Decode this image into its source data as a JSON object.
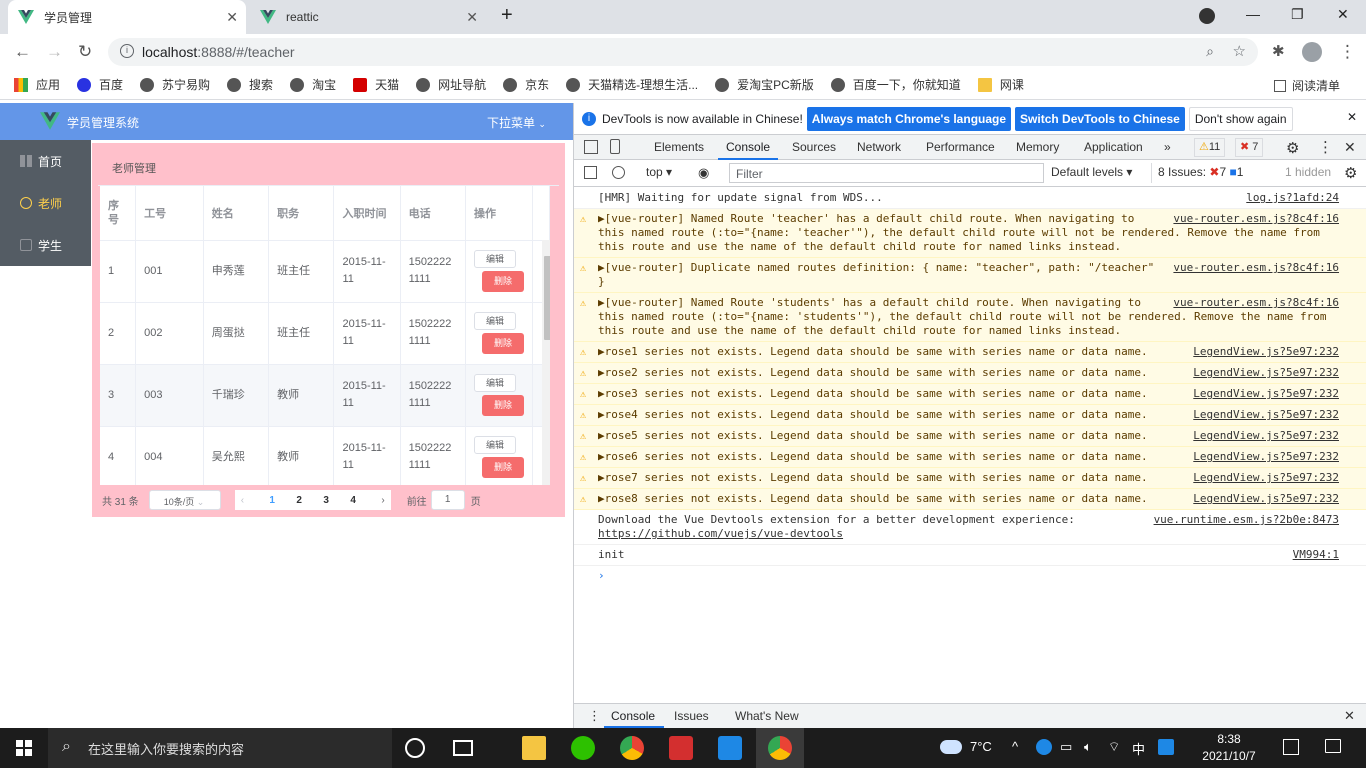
{
  "browser": {
    "tabs": [
      {
        "title": "学员管理",
        "active": true
      },
      {
        "title": "reattic",
        "active": false
      }
    ],
    "url_host": "localhost",
    "url_rest": ":8888/#/teacher",
    "bookmarks": [
      "应用",
      "百度",
      "苏宁易购",
      "搜索",
      "淘宝",
      "天猫",
      "网址导航",
      "京东",
      "天猫精选-理想生活...",
      "爱淘宝PC新版",
      "百度一下，你就知道",
      "网课"
    ],
    "reading_list": "阅读清单"
  },
  "app": {
    "title": "学员管理系统",
    "dropdown": "下拉菜单",
    "sidebar": [
      {
        "label": "首页",
        "active": false
      },
      {
        "label": "老师",
        "active": true
      },
      {
        "label": "学生",
        "active": false
      }
    ],
    "panel_title": "老师管理",
    "table": {
      "headers": [
        "序号",
        "工号",
        "姓名",
        "职务",
        "入职时间",
        "电话",
        "操作"
      ],
      "rows": [
        {
          "idx": "1",
          "id": "001",
          "name": "申秀莲",
          "role": "班主任",
          "date": "2015-11-11",
          "phone": "15022221111"
        },
        {
          "idx": "2",
          "id": "002",
          "name": "周蛋挞",
          "role": "班主任",
          "date": "2015-11-11",
          "phone": "15022221111"
        },
        {
          "idx": "3",
          "id": "003",
          "name": "千瑞珍",
          "role": "教师",
          "date": "2015-11-11",
          "phone": "15022221111"
        },
        {
          "idx": "4",
          "id": "004",
          "name": "吴允熙",
          "role": "教师",
          "date": "2015-11-11",
          "phone": "15022221111"
        }
      ],
      "edit_label": "编辑",
      "delete_label": "删除"
    },
    "pagination": {
      "total": "共 31 条",
      "page_size": "10条/页",
      "pages": [
        "1",
        "2",
        "3",
        "4"
      ],
      "current": "1",
      "goto_label": "前往",
      "goto_value": "1",
      "page_suffix": "页"
    }
  },
  "devtools": {
    "infobar": {
      "text": "DevTools is now available in Chinese!",
      "btn_match": "Always match Chrome's language",
      "btn_switch": "Switch DevTools to Chinese",
      "btn_dismiss": "Don't show again"
    },
    "tabs": [
      "Elements",
      "Console",
      "Sources",
      "Network",
      "Performance",
      "Memory",
      "Application"
    ],
    "warn_count": "11",
    "error_count": "7",
    "context": "top",
    "filter_placeholder": "Filter",
    "levels": "Default levels",
    "issues_label": "8 Issues:",
    "issues_errors": "7",
    "issues_info": "1",
    "hidden": "1 hidden",
    "messages": [
      {
        "type": "log",
        "text": "[HMR] Waiting for update signal from WDS...",
        "source": "log.js?1afd:24"
      },
      {
        "type": "warn",
        "text": "▶[vue-router] Named Route 'teacher' has a default child route. When navigating to\nthis named route (:to=\"{name: 'teacher'\"), the default child route will not be rendered. Remove the name from\nthis route and use the name of the default child route for named links instead.",
        "source": "vue-router.esm.js?8c4f:16"
      },
      {
        "type": "warn",
        "text": "▶[vue-router] Duplicate named routes definition: { name: \"teacher\", path: \"/teacher\"\n}",
        "source": "vue-router.esm.js?8c4f:16"
      },
      {
        "type": "warn",
        "text": "▶[vue-router] Named Route 'students' has a default child route. When navigating to\nthis named route (:to=\"{name: 'students'\"), the default child route will not be rendered. Remove the name from\nthis route and use the name of the default child route for named links instead.",
        "source": "vue-router.esm.js?8c4f:16"
      },
      {
        "type": "warn",
        "text": "▶rose1 series not exists. Legend data should be same with series name or data name.",
        "source": "LegendView.js?5e97:232"
      },
      {
        "type": "warn",
        "text": "▶rose2 series not exists. Legend data should be same with series name or data name.",
        "source": "LegendView.js?5e97:232"
      },
      {
        "type": "warn",
        "text": "▶rose3 series not exists. Legend data should be same with series name or data name.",
        "source": "LegendView.js?5e97:232"
      },
      {
        "type": "warn",
        "text": "▶rose4 series not exists. Legend data should be same with series name or data name.",
        "source": "LegendView.js?5e97:232"
      },
      {
        "type": "warn",
        "text": "▶rose5 series not exists. Legend data should be same with series name or data name.",
        "source": "LegendView.js?5e97:232"
      },
      {
        "type": "warn",
        "text": "▶rose6 series not exists. Legend data should be same with series name or data name.",
        "source": "LegendView.js?5e97:232"
      },
      {
        "type": "warn",
        "text": "▶rose7 series not exists. Legend data should be same with series name or data name.",
        "source": "LegendView.js?5e97:232"
      },
      {
        "type": "warn",
        "text": "▶rose8 series not exists. Legend data should be same with series name or data name.",
        "source": "LegendView.js?5e97:232"
      },
      {
        "type": "log",
        "text": "Download the Vue Devtools extension for a better development experience:",
        "link": "https://github.com/vuejs/vue-devtools",
        "source": "vue.runtime.esm.js?2b0e:8473"
      },
      {
        "type": "log",
        "text": "init",
        "source": "VM994:1"
      }
    ],
    "drawer_tabs": [
      "Console",
      "Issues",
      "What's New"
    ]
  },
  "taskbar": {
    "search_placeholder": "在这里输入你要搜索的内容",
    "weather": "7°C",
    "ime": "中",
    "time": "8:38",
    "date": "2021/10/7"
  },
  "colors": {
    "app_header": "#6396e8",
    "sidebar": "#545c64",
    "sidebar_active": "#ffd04b",
    "panel": "#ffc0cb",
    "delete": "#f56c6c",
    "devtools_accent": "#1a73e8"
  }
}
